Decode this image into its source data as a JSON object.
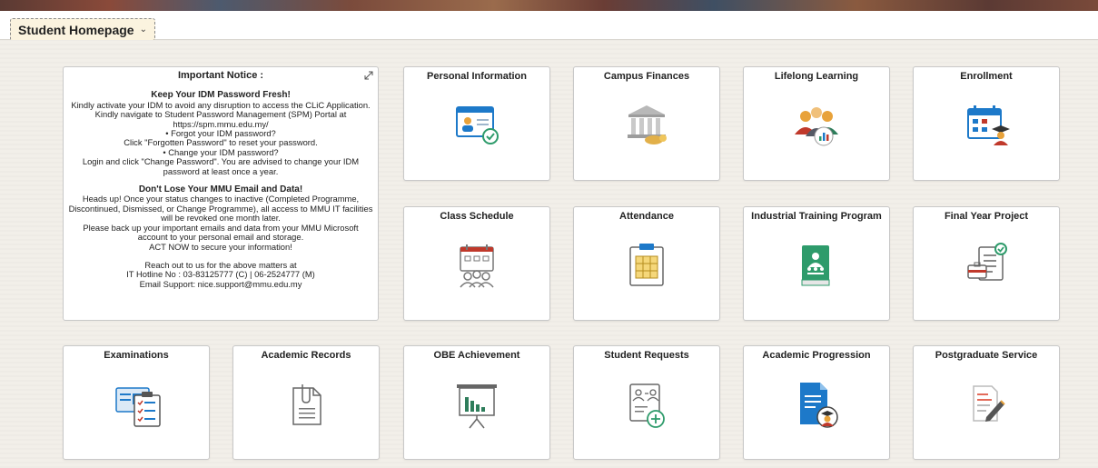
{
  "header": {
    "title": "Student Homepage",
    "dropdown_icon": "chevron-down-icon"
  },
  "notice": {
    "title": "Important Notice :",
    "expand_icon": "expand-icon",
    "heading1": "Keep Your IDM Password Fresh!",
    "lines1": [
      "Kindly activate your IDM to avoid any disruption to access the CLiC Application.",
      "Kindly navigate to Student Password Management (SPM) Portal at",
      "https://spm.mmu.edu.my/",
      "• Forgot your IDM password?",
      "Click \"Forgotten Password\" to reset your password.",
      "• Change your IDM password?",
      "Login and click \"Change Password\". You are advised to change your IDM",
      "password at least once a year."
    ],
    "heading2": "Don't Lose Your MMU Email and Data!",
    "lines2": [
      "Heads up! Once your status changes to inactive (Completed Programme,",
      "Discontinued, Dismissed, or Change Programme), all access to MMU IT facilities",
      "will be revoked one month later.",
      "Please back up your important emails and data from your MMU Microsoft",
      "account to your personal email and storage.",
      "ACT NOW to secure your information!"
    ],
    "lines3": [
      "Reach out to us for the above matters at",
      "IT Hotline No : 03-83125777 (C) | 06-2524777 (M)",
      "Email Support: nice.support@mmu.edu.my"
    ]
  },
  "tiles": [
    {
      "label": "Personal Information",
      "icon": "personal-info-icon"
    },
    {
      "label": "Campus Finances",
      "icon": "bank-icon"
    },
    {
      "label": "Lifelong Learning",
      "icon": "group-chart-icon"
    },
    {
      "label": "Enrollment",
      "icon": "calendar-student-icon"
    },
    {
      "label": "Class Schedule",
      "icon": "class-schedule-icon"
    },
    {
      "label": "Attendance",
      "icon": "attendance-clipboard-icon"
    },
    {
      "label": "Industrial Training Program",
      "icon": "training-book-icon"
    },
    {
      "label": "Final Year Project",
      "icon": "project-document-icon"
    },
    {
      "label": "Examinations",
      "icon": "exam-checklist-icon"
    },
    {
      "label": "Academic Records",
      "icon": "records-clip-icon"
    },
    {
      "label": "OBE Achievement",
      "icon": "presentation-chart-icon"
    },
    {
      "label": "Student Requests",
      "icon": "request-add-icon"
    },
    {
      "label": "Academic Progression",
      "icon": "progression-document-icon"
    },
    {
      "label": "Postgraduate Service",
      "icon": "pen-document-icon"
    }
  ],
  "colors": {
    "accent_blue": "#1d79c9",
    "accent_green": "#2e9b6b",
    "accent_orange": "#e8a23a"
  }
}
